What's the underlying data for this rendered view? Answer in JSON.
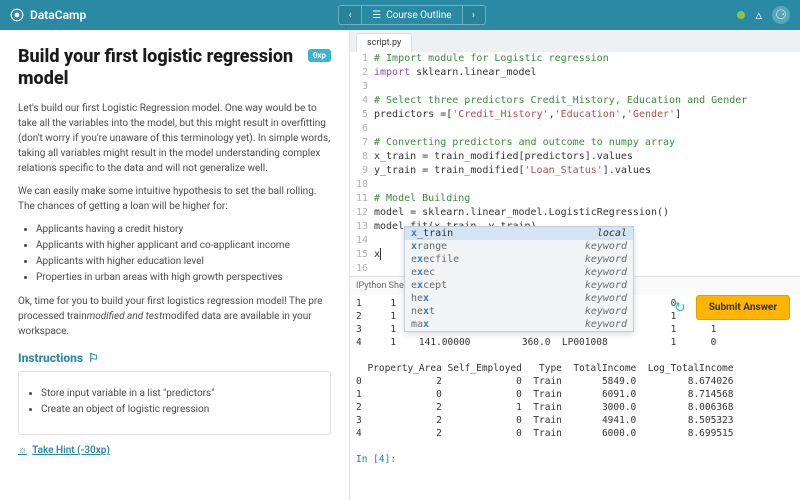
{
  "topbar": {
    "brand": "DataCamp",
    "outline": "Course Outline"
  },
  "lesson": {
    "title": "Build your first logistic regression model",
    "xp": "0xp",
    "p1": "Let's build our first Logistic Regression model. One way would be to take all the variables into the model, but this might result in overfitting (don't worry if you're unaware of this terminology yet). In simple words, taking all variables might result in the model understanding complex relations specific to the data and will not generalize well.",
    "p2": "We can easily make some intuitive hypothesis to set the ball rolling. The chances of getting a loan will be higher for:",
    "bul": [
      "Applicants having a credit history",
      "Applicants with higher applicant and co-applicant income",
      "Applicants with higher education level",
      "Properties in urban areas with high growth perspectives"
    ],
    "p3a": "Ok, time for you to build your first logistics regression model! The pre processed train",
    "p3b": "modified and test",
    "p3c": "modifed data are available in your workspace.",
    "instr_h": "Instructions",
    "instr": [
      "Store input variable in a list \"predictors\"",
      "Create an object of logistic regression"
    ],
    "hint": "Take Hint (-30xp)"
  },
  "editor": {
    "tab": "script.py",
    "lines": [
      {
        "n": 1,
        "seg": [
          {
            "c": "cm",
            "t": "# Import module for Logistic regression"
          }
        ]
      },
      {
        "n": 2,
        "seg": [
          {
            "c": "kw",
            "t": "import"
          },
          {
            "c": "",
            "t": " sklearn.linear_model"
          }
        ]
      },
      {
        "n": 3,
        "seg": []
      },
      {
        "n": 4,
        "seg": [
          {
            "c": "cm",
            "t": "# Select three predictors Credit_History, Education and Gender"
          }
        ]
      },
      {
        "n": 5,
        "seg": [
          {
            "c": "",
            "t": "predictors =["
          },
          {
            "c": "st",
            "t": "'Credit_History'"
          },
          {
            "c": "",
            "t": ","
          },
          {
            "c": "st",
            "t": "'Education'"
          },
          {
            "c": "",
            "t": ","
          },
          {
            "c": "st",
            "t": "'Gender'"
          },
          {
            "c": "",
            "t": "]"
          }
        ]
      },
      {
        "n": 6,
        "seg": []
      },
      {
        "n": 7,
        "seg": [
          {
            "c": "cm",
            "t": "# Converting predictors and outcome to numpy array"
          }
        ]
      },
      {
        "n": 8,
        "seg": [
          {
            "c": "",
            "t": "x_train = train_modified[predictors].values"
          }
        ]
      },
      {
        "n": 9,
        "seg": [
          {
            "c": "",
            "t": "y_train = train_modified["
          },
          {
            "c": "st",
            "t": "'Loan_Status'"
          },
          {
            "c": "",
            "t": "].values"
          }
        ]
      },
      {
        "n": 10,
        "seg": []
      },
      {
        "n": 11,
        "seg": [
          {
            "c": "cm",
            "t": "# Model Building"
          }
        ]
      },
      {
        "n": 12,
        "seg": [
          {
            "c": "",
            "t": "model = sklearn.linear_model.LogisticRegression()"
          }
        ]
      },
      {
        "n": 13,
        "seg": [
          {
            "c": "",
            "t": "model.fit(x_train, y_train)"
          }
        ]
      },
      {
        "n": 14,
        "seg": []
      },
      {
        "n": 15,
        "seg": [
          {
            "c": "",
            "t": "x"
          }
        ],
        "cursor": true
      },
      {
        "n": 16,
        "seg": []
      }
    ],
    "ac": [
      {
        "l": "x_train",
        "r": "local",
        "sel": true,
        "hl": "x"
      },
      {
        "l": "xrange",
        "r": "keyword",
        "hl": "x"
      },
      {
        "l": "execfile",
        "r": "keyword",
        "hl": "x"
      },
      {
        "l": "exec",
        "r": "keyword",
        "hl": "x"
      },
      {
        "l": "except",
        "r": "keyword",
        "hl": "x"
      },
      {
        "l": "hex",
        "r": "keyword",
        "hl": "x"
      },
      {
        "l": "next",
        "r": "keyword",
        "hl": "x"
      },
      {
        "l": "max",
        "r": "keyword",
        "hl": "x"
      }
    ]
  },
  "shell": {
    "label": "IPython Shell",
    "body": "1     1    128.00000         360.0  LP001003           0      1\n2     1     66.00000         360.0  LP001005           1      1\n3     1    120.00000         360.0  LP001006           1      1\n4     1    141.00000         360.0  LP001008           1      0\n\n  Property_Area Self_Employed   Type  TotalIncome  Log_TotalIncome\n0             2             0  Train       5849.0         8.674026\n1             0             0  Train       6091.0         8.714568\n2             2             1  Train       3000.0         8.006368\n3             2             0  Train       4941.0         8.505323\n4             2             0  Train       6000.0         8.699515",
    "prompt": "In [4]:"
  },
  "actions": {
    "submit": "Submit Answer"
  }
}
